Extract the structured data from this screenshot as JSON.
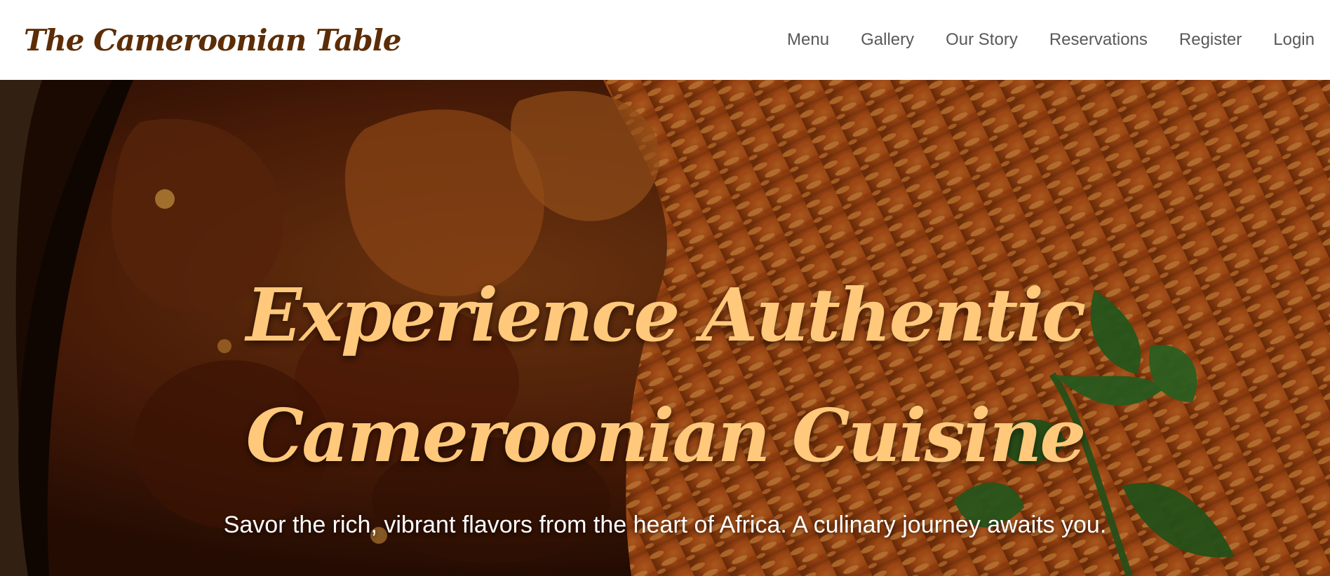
{
  "header": {
    "brand": "The Cameroonian Table",
    "nav": [
      {
        "label": "Menu"
      },
      {
        "label": "Gallery"
      },
      {
        "label": "Our Story"
      },
      {
        "label": "Reservations"
      },
      {
        "label": "Register"
      },
      {
        "label": "Login"
      }
    ]
  },
  "hero": {
    "title": "Experience Authentic Cameroonian Cuisine",
    "subtitle": "Savor the rich, vibrant flavors from the heart of Africa. A culinary journey awaits you.",
    "background_image": "jollof-rice-with-grilled-chicken-and-parsley"
  },
  "colors": {
    "brand": "#5c2d06",
    "nav_text": "#595959",
    "hero_title": "#ffc87a",
    "hero_subtitle": "#ffffff"
  }
}
